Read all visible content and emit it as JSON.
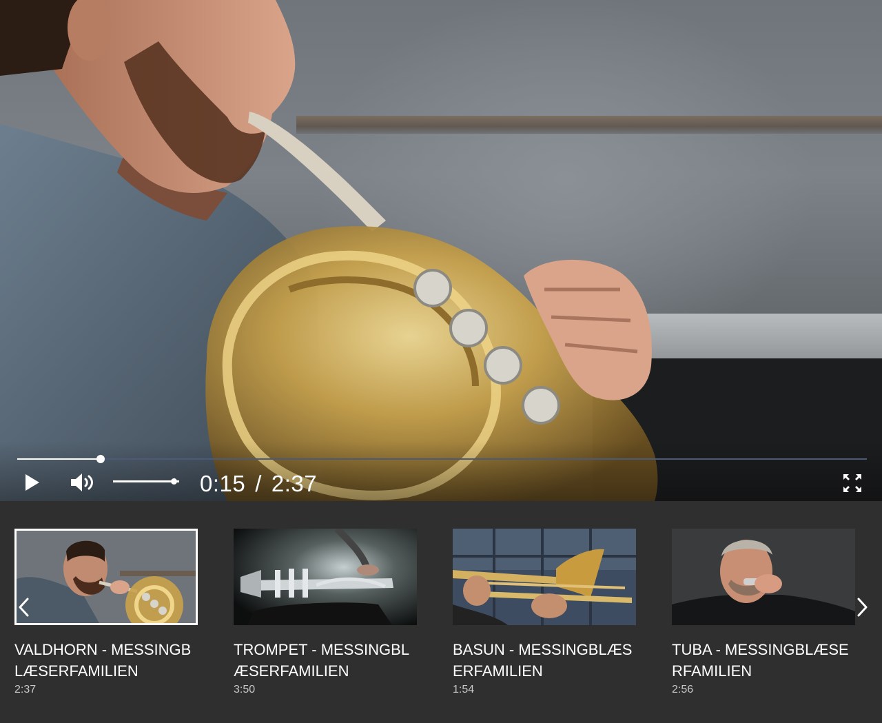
{
  "player": {
    "current_time": "0:15",
    "separator": "/",
    "total_time": "2:37",
    "progress_fraction": 0.098,
    "volume_fraction": 0.92,
    "icons": {
      "play": "play-icon",
      "volume": "volume-icon",
      "fullscreen": "fullscreen-icon"
    }
  },
  "playlist": {
    "icons": {
      "prev": "chevron-left-icon",
      "next": "chevron-right-icon"
    },
    "items": [
      {
        "title": "VALDHORN - MESSINGBLÆSERFAMILIEN",
        "duration": "2:37",
        "active": true
      },
      {
        "title": "TROMPET - MESSINGBLÆSERFAMILIEN",
        "duration": "3:50",
        "active": false
      },
      {
        "title": "BASUN - MESSINGBLÆSERFAMILIEN",
        "duration": "1:54",
        "active": false
      },
      {
        "title": "TUBA - MESSINGBLÆSERFAMILIEN",
        "duration": "2:56",
        "active": false
      }
    ]
  },
  "colors": {
    "background": "#2f2f2f",
    "progress_track": "#4a5a78",
    "progress_fill": "#ffffff",
    "brass": "#c9a24a"
  }
}
